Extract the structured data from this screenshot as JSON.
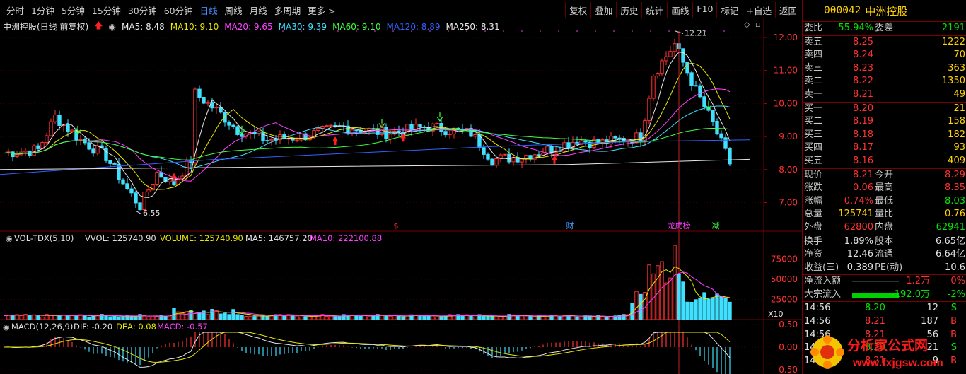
{
  "toolbar": {
    "periods": [
      "分时",
      "1分钟",
      "5分钟",
      "15分钟",
      "30分钟",
      "60分钟",
      "日线",
      "周线",
      "月线",
      "多周期",
      "更多 >"
    ],
    "active_index": 6,
    "buttons": [
      "复权",
      "叠加",
      "历史",
      "统计",
      "画线",
      "F10",
      "标记",
      "+自选",
      "返回"
    ]
  },
  "stock": {
    "code": "000042",
    "name": "中洲控股"
  },
  "main_legend": {
    "title": "中洲控股(日线 前复权)",
    "mas": [
      {
        "label": "MA5: 8.48",
        "color": "#e8e8e8"
      },
      {
        "label": "MA10: 9.10",
        "color": "#e8e800"
      },
      {
        "label": "MA20: 9.65",
        "color": "#ff40ff"
      },
      {
        "label": "MA30: 9.39",
        "color": "#40e0ff"
      },
      {
        "label": "MA60: 9.10",
        "color": "#40ff40"
      },
      {
        "label": "MA120: 8.89",
        "color": "#3060ff"
      },
      {
        "label": "MA250: 8.31",
        "color": "#e8e8e8"
      }
    ]
  },
  "price_axis": [
    "12.00",
    "11.00",
    "10.00",
    "9.00",
    "8.00",
    "7.00"
  ],
  "annotations": {
    "high": "12.21",
    "low": "6.55",
    "markers": [
      "$",
      "财",
      "龙虎榜",
      "减"
    ]
  },
  "vol_legend": {
    "label": "VOL-TDX(5,10)",
    "vvol": "VVOL: 125740.90",
    "volume": "VOLUME: 125740.90",
    "ma5": "MA5: 146757.20",
    "ma10": "MA10: 222100.88"
  },
  "vol_axis": [
    "75000",
    "50000",
    "25000"
  ],
  "vol_unit": "X10",
  "macd_legend": {
    "label": "MACD(12,26,9)",
    "dif": "DIF: -0.20",
    "dea": "DEA: 0.08",
    "macd": "MACD: -0.57"
  },
  "macd_axis": [
    "0.50",
    "0.00",
    "-0.50"
  ],
  "quote": {
    "weibi": {
      "label": "委比",
      "value": "-55.94%",
      "label2": "委差",
      "value2": "-2191"
    },
    "sell": [
      {
        "label": "卖五",
        "price": "8.25",
        "vol": "1222"
      },
      {
        "label": "卖四",
        "price": "8.24",
        "vol": "70"
      },
      {
        "label": "卖三",
        "price": "8.23",
        "vol": "363"
      },
      {
        "label": "卖二",
        "price": "8.22",
        "vol": "1350"
      },
      {
        "label": "卖一",
        "price": "8.21",
        "vol": "49"
      }
    ],
    "buy": [
      {
        "label": "买一",
        "price": "8.20",
        "vol": "21"
      },
      {
        "label": "买二",
        "price": "8.19",
        "vol": "158"
      },
      {
        "label": "买三",
        "price": "8.18",
        "vol": "182"
      },
      {
        "label": "买四",
        "price": "8.17",
        "vol": "93"
      },
      {
        "label": "买五",
        "price": "8.16",
        "vol": "409"
      }
    ],
    "stats1": [
      {
        "l": "现价",
        "v": "8.21",
        "l2": "今开",
        "v2": "8.29"
      },
      {
        "l": "涨跌",
        "v": "0.06",
        "l2": "最高",
        "v2": "8.35"
      },
      {
        "l": "涨幅",
        "v": "0.74%",
        "l2": "最低",
        "v2": "8.03"
      },
      {
        "l": "总量",
        "v": "125741",
        "l2": "量比",
        "v2": "0.76"
      },
      {
        "l": "外盘",
        "v": "62800",
        "l2": "内盘",
        "v2": "62941"
      }
    ],
    "stats2": [
      {
        "l": "换手",
        "v": "1.89%",
        "l2": "股本",
        "v2": "6.65亿"
      },
      {
        "l": "净资",
        "v": "12.46",
        "l2": "流通",
        "v2": "6.64亿"
      },
      {
        "l": "收益(三)",
        "v": "0.389",
        "l2": "PE(动)",
        "v2": "10.6"
      }
    ],
    "flow": [
      {
        "l": "净流入额",
        "v": "1.2万",
        "p": "0%"
      },
      {
        "l": "大宗流入",
        "v": "-192.0万",
        "p": "-2%"
      }
    ],
    "ticks": [
      {
        "t": "14:56",
        "p": "8.20",
        "v": "12",
        "s": "S"
      },
      {
        "t": "14:56",
        "p": "8.21",
        "v": "187",
        "s": "B"
      },
      {
        "t": "14:56",
        "p": "8.21",
        "v": "56",
        "s": "B"
      },
      {
        "t": "14:56",
        "p": "8.20",
        "v": "21",
        "s": "S"
      },
      {
        "t": "14:57",
        "p": "8.21",
        "v": "9",
        "s": "B"
      }
    ]
  },
  "watermark": {
    "title": "分析家公式网",
    "url": "www.fxjgsw.com"
  }
}
